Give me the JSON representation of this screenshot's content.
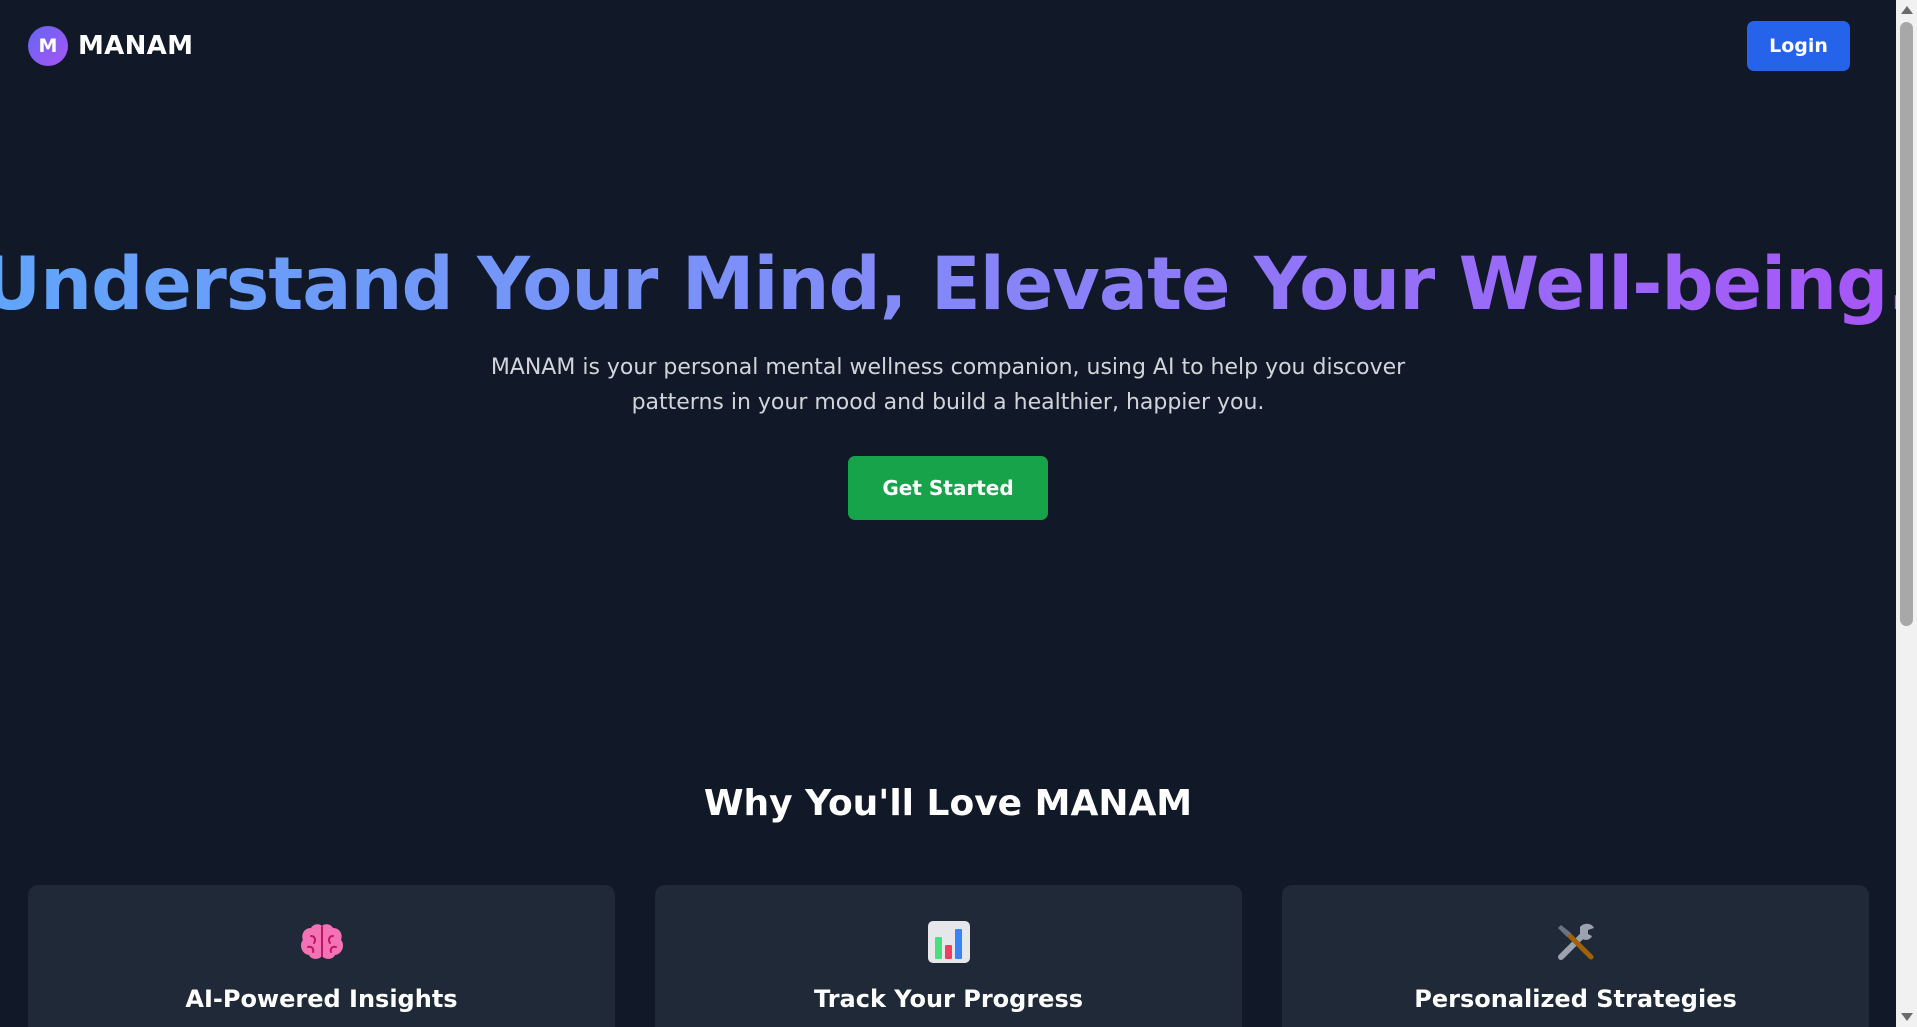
{
  "header": {
    "logo_letter": "M",
    "brand_name": "MANAM",
    "login_label": "Login"
  },
  "hero": {
    "title": "Understand Your Mind, Elevate Your Well-being.",
    "subtitle": "MANAM is your personal mental wellness companion, using AI to help you discover patterns in your mood and build a healthier, happier you.",
    "cta_label": "Get Started"
  },
  "features": {
    "title": "Why You'll Love MANAM",
    "cards": [
      {
        "icon": "brain-icon",
        "title": "AI-Powered Insights"
      },
      {
        "icon": "bar-chart-icon",
        "title": "Track Your Progress"
      },
      {
        "icon": "tools-icon",
        "title": "Personalized Strategies"
      }
    ]
  },
  "colors": {
    "background": "#111827",
    "card": "#1f2937",
    "login_button": "#2563eb",
    "cta_button": "#16a34a",
    "title_gradient_start": "#60a5fa",
    "title_gradient_end": "#a855f7"
  }
}
